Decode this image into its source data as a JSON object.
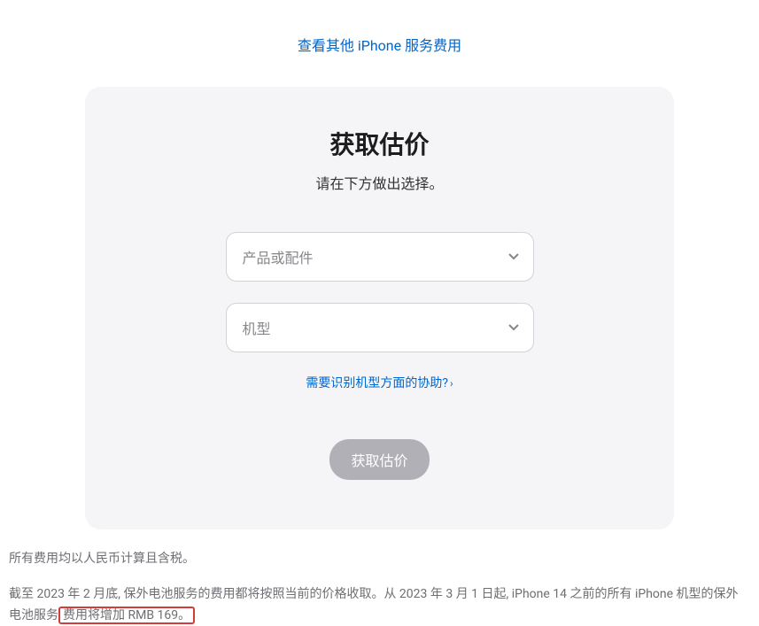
{
  "topLink": {
    "label": "查看其他 iPhone 服务费用"
  },
  "card": {
    "title": "获取估价",
    "subtitle": "请在下方做出选择。"
  },
  "selectProduct": {
    "placeholder": "产品或配件"
  },
  "selectModel": {
    "placeholder": "机型"
  },
  "helpLink": {
    "label": "需要识别机型方面的协助?"
  },
  "submit": {
    "label": "获取估价"
  },
  "footer": {
    "line1": "所有费用均以人民币计算且含税。",
    "line2_before": "截至 2023 年 2 月底, 保外电池服务的费用都将按照当前的价格收取。从 2023 年 3 月 1 日起, iPhone 14 之前的所有 iPhone 机型的保外电池服务",
    "line2_highlight": "费用将增加 RMB 169。"
  }
}
